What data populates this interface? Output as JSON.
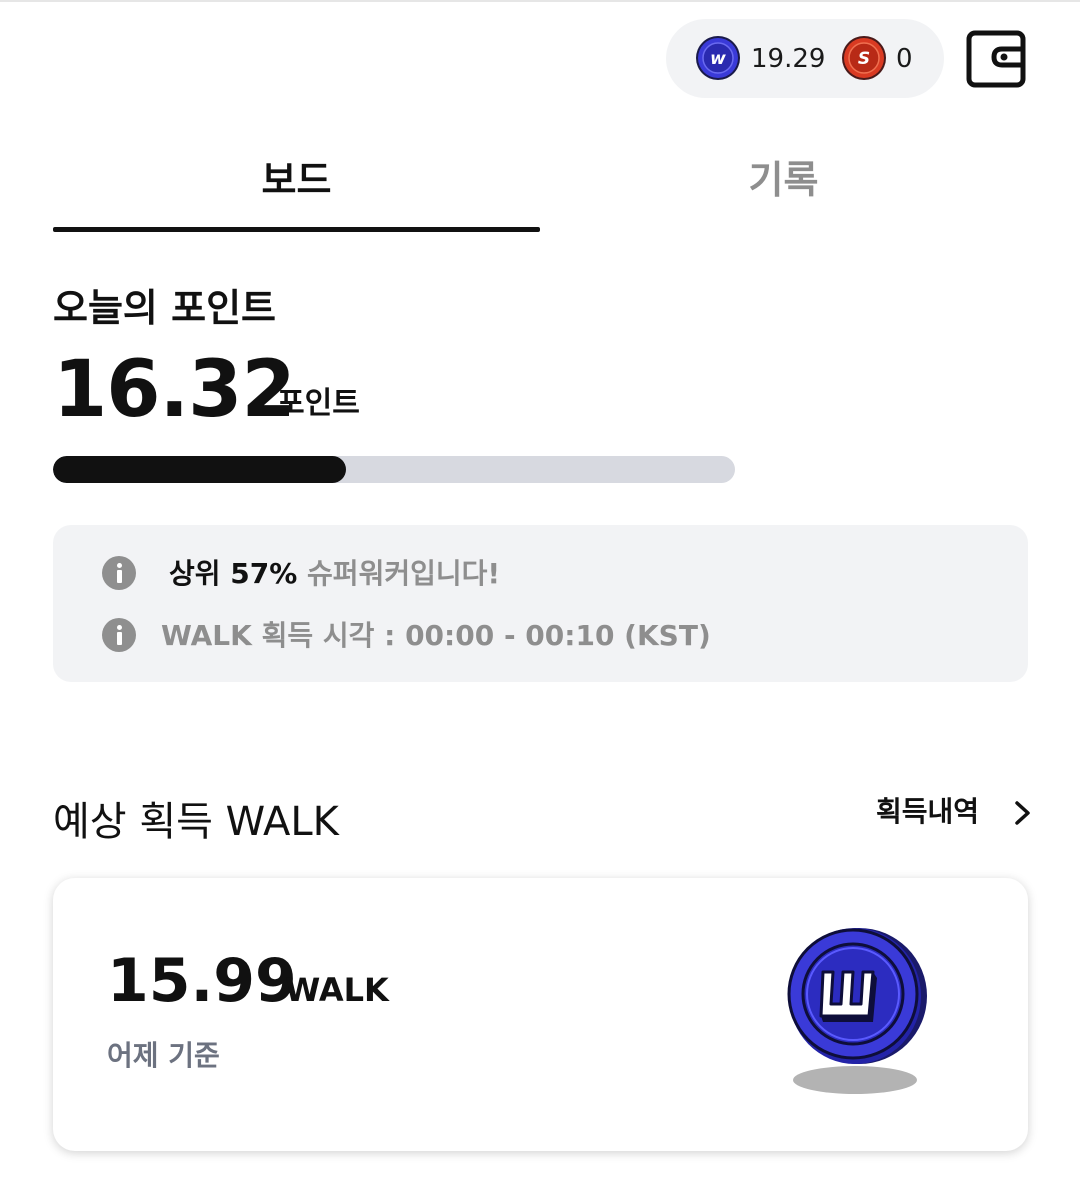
{
  "header": {
    "walk_balance": "19.29",
    "super_balance": "0",
    "walk_coin_letter": "w",
    "super_coin_letter": "S",
    "wallet_icon": "wallet-icon"
  },
  "tabs": [
    {
      "label": "보드",
      "active": true
    },
    {
      "label": "기록",
      "active": false
    }
  ],
  "today": {
    "title": "오늘의 포인트",
    "value": "16.32",
    "unit": "포인트",
    "progress_fraction": 0.43
  },
  "info": {
    "rank_prefix": "상위 57%",
    "rank_suffix": " 슈퍼워커입니다!",
    "walk_time": "WALK 획득 시각 : 00:00 - 00:10 (KST)",
    "icon": "info-icon"
  },
  "expected": {
    "title": "예상 획득 WALK",
    "history_label": "획득내역",
    "value": "15.99",
    "unit": "WALK",
    "basis": "어제 기준"
  },
  "colors": {
    "walk_coin": "#3a3ad8",
    "super_coin": "#d93a22",
    "progress_fill": "#111111",
    "progress_track": "#d7d9e0",
    "muted_text": "#8e8e8e"
  }
}
